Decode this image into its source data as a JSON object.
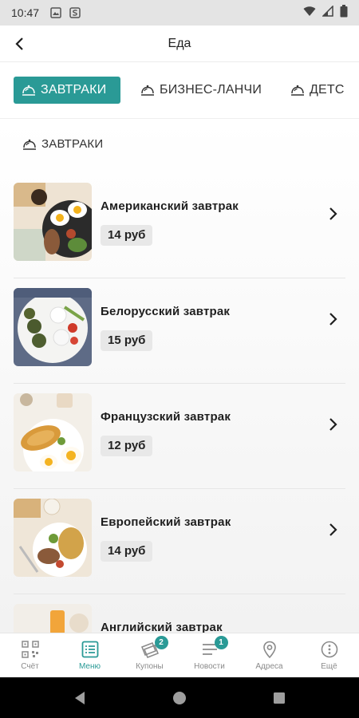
{
  "status_bar": {
    "time": "10:47"
  },
  "app_bar": {
    "title": "Еда"
  },
  "tabs": [
    {
      "label": "ЗАВТРАКИ",
      "active": true
    },
    {
      "label": "БИЗНЕС-ЛАНЧИ",
      "active": false
    },
    {
      "label": "ДЕТС",
      "active": false
    }
  ],
  "section": {
    "heading": "ЗАВТРАКИ"
  },
  "items": [
    {
      "name": "Американский завтрак",
      "price": "14 руб"
    },
    {
      "name": "Белорусский завтрак",
      "price": "15 руб"
    },
    {
      "name": "Французский завтрак",
      "price": "12 руб"
    },
    {
      "name": "Европейский завтрак",
      "price": "14 руб"
    },
    {
      "name": "Английский завтрак",
      "price": ""
    }
  ],
  "bottom_nav": [
    {
      "label": "Счёт",
      "icon": "qr-code-icon",
      "badge": ""
    },
    {
      "label": "Меню",
      "icon": "menu-list-icon",
      "badge": "",
      "active": true
    },
    {
      "label": "Купоны",
      "icon": "coupons-icon",
      "badge": "2"
    },
    {
      "label": "Новости",
      "icon": "news-icon",
      "badge": "1"
    },
    {
      "label": "Адреса",
      "icon": "location-pin-icon",
      "badge": ""
    },
    {
      "label": "Ещё",
      "icon": "more-icon",
      "badge": ""
    }
  ],
  "colors": {
    "accent": "#2a9a96",
    "status_bar": "#e4e4e4",
    "nav_inactive": "#8a8a8a"
  }
}
